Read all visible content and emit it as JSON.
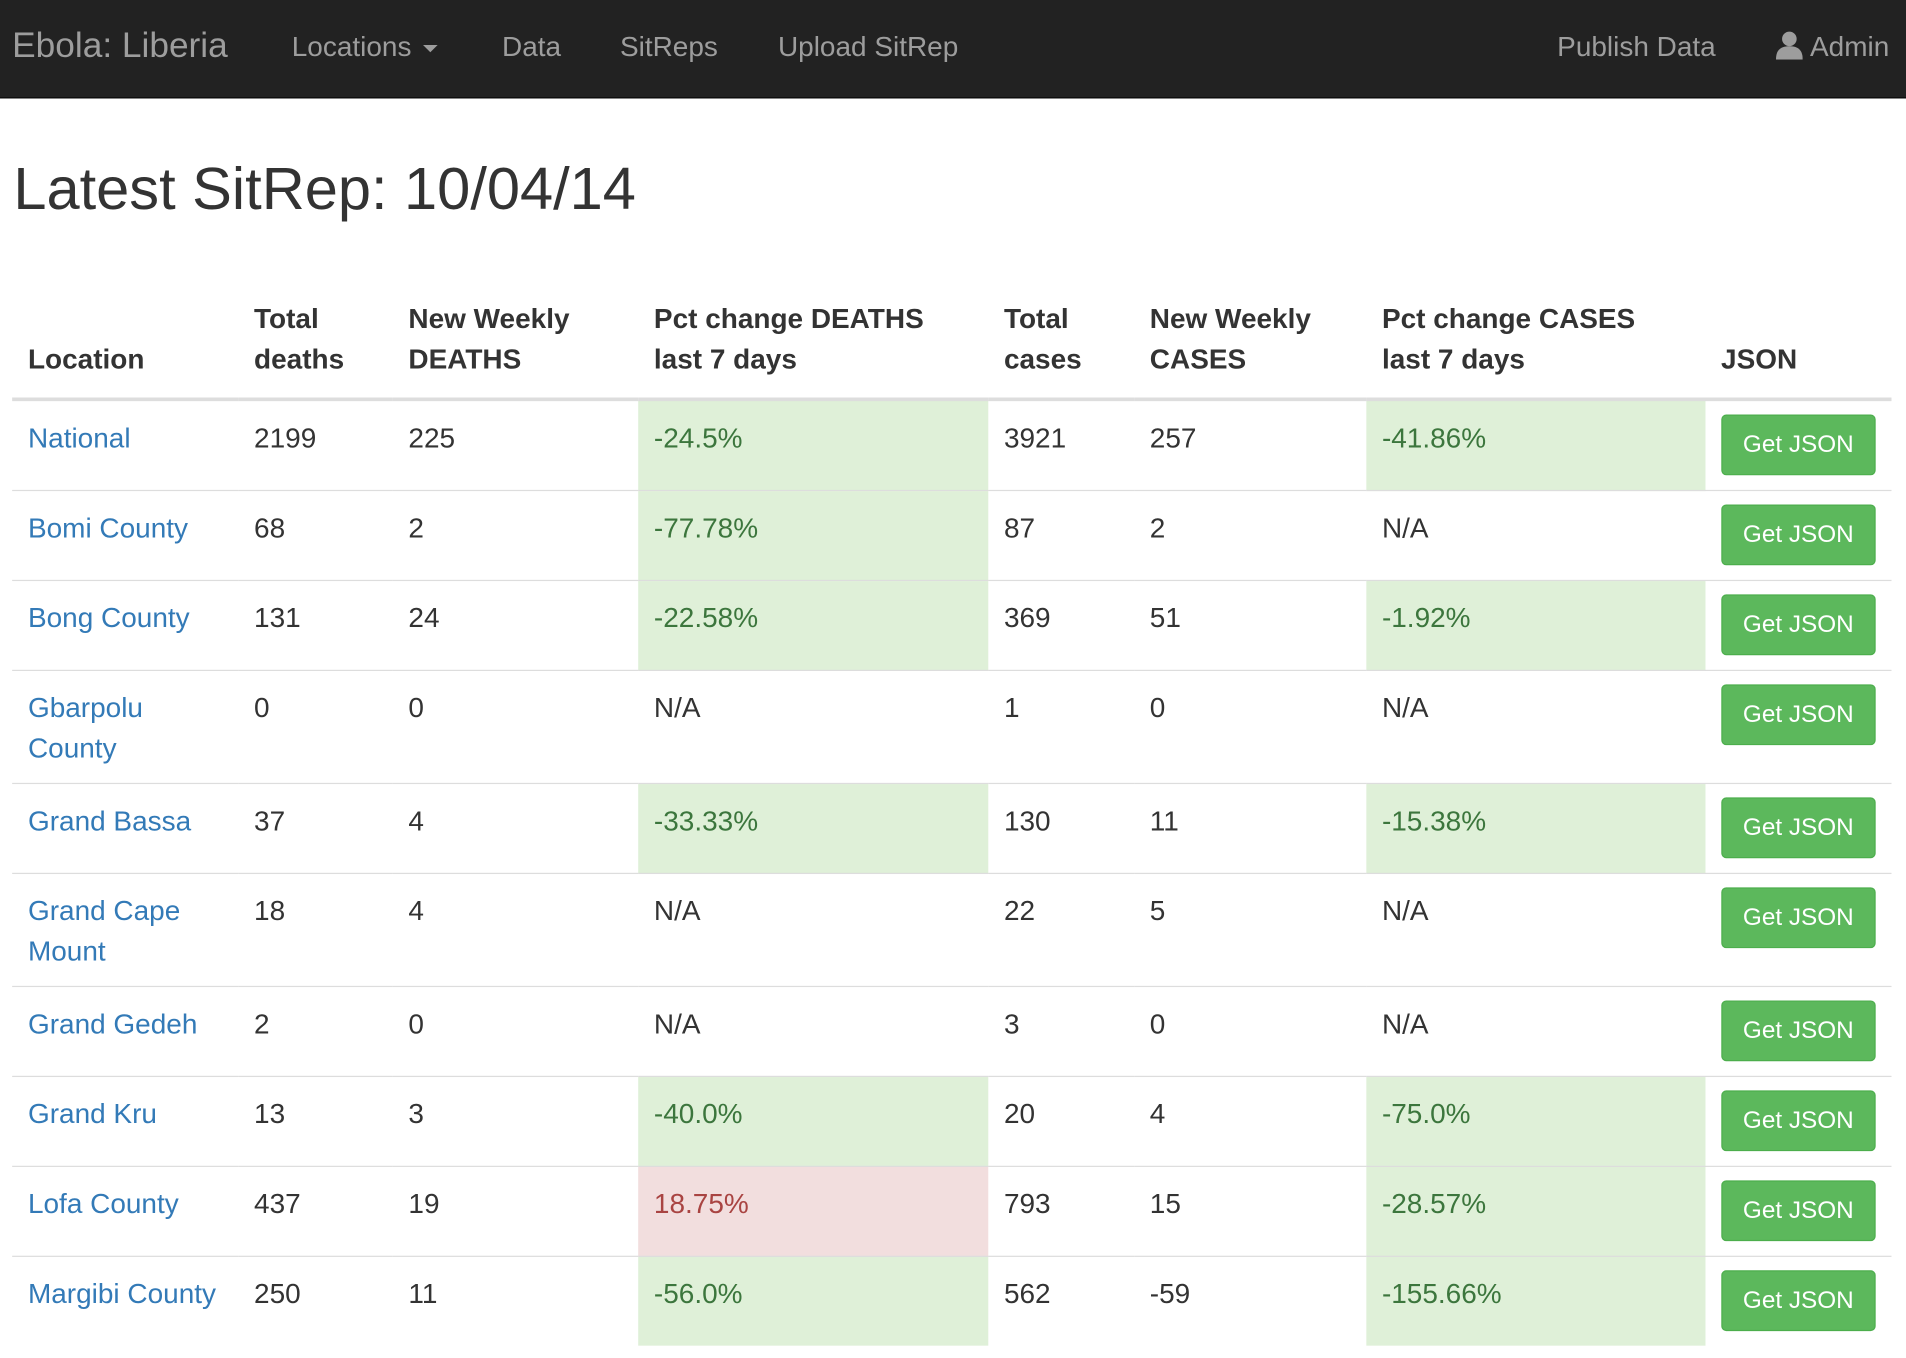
{
  "navbar": {
    "brand": "Ebola: Liberia",
    "locations": "Locations",
    "data": "Data",
    "sitreps": "SitReps",
    "upload": "Upload SitRep",
    "publish": "Publish Data",
    "admin": "Admin"
  },
  "page": {
    "title": "Latest SitRep: 10/04/14"
  },
  "table": {
    "headers": {
      "location": "Location",
      "total_deaths": [
        "Total",
        "deaths"
      ],
      "new_deaths": [
        "New Weekly",
        "DEATHS"
      ],
      "pct_deaths": [
        "Pct change DEATHS",
        "last 7 days"
      ],
      "total_cases": [
        "Total",
        "cases"
      ],
      "new_cases": [
        "New Weekly",
        "CASES"
      ],
      "pct_cases": [
        "Pct change CASES",
        "last 7 days"
      ],
      "json": "JSON"
    },
    "button_label": "Get JSON",
    "rows": [
      {
        "location": [
          "National"
        ],
        "total_deaths": "2199",
        "new_deaths": "225",
        "pct_deaths": "-24.5%",
        "total_cases": "3921",
        "new_cases": "257",
        "pct_cases": "-41.86%"
      },
      {
        "location": [
          "Bomi County"
        ],
        "total_deaths": "68",
        "new_deaths": "2",
        "pct_deaths": "-77.78%",
        "total_cases": "87",
        "new_cases": "2",
        "pct_cases": "N/A"
      },
      {
        "location": [
          "Bong County"
        ],
        "total_deaths": "131",
        "new_deaths": "24",
        "pct_deaths": "-22.58%",
        "total_cases": "369",
        "new_cases": "51",
        "pct_cases": "-1.92%"
      },
      {
        "location": [
          "Gbarpolu",
          "County"
        ],
        "total_deaths": "0",
        "new_deaths": "0",
        "pct_deaths": "N/A",
        "total_cases": "1",
        "new_cases": "0",
        "pct_cases": "N/A"
      },
      {
        "location": [
          "Grand Bassa"
        ],
        "total_deaths": "37",
        "new_deaths": "4",
        "pct_deaths": "-33.33%",
        "total_cases": "130",
        "new_cases": "11",
        "pct_cases": "-15.38%"
      },
      {
        "location": [
          "Grand Cape",
          "Mount"
        ],
        "total_deaths": "18",
        "new_deaths": "4",
        "pct_deaths": "N/A",
        "total_cases": "22",
        "new_cases": "5",
        "pct_cases": "N/A"
      },
      {
        "location": [
          "Grand Gedeh"
        ],
        "total_deaths": "2",
        "new_deaths": "0",
        "pct_deaths": "N/A",
        "total_cases": "3",
        "new_cases": "0",
        "pct_cases": "N/A"
      },
      {
        "location": [
          "Grand Kru"
        ],
        "total_deaths": "13",
        "new_deaths": "3",
        "pct_deaths": "-40.0%",
        "total_cases": "20",
        "new_cases": "4",
        "pct_cases": "-75.0%"
      },
      {
        "location": [
          "Lofa County"
        ],
        "total_deaths": "437",
        "new_deaths": "19",
        "pct_deaths": "18.75%",
        "total_cases": "793",
        "new_cases": "15",
        "pct_cases": "-28.57%"
      },
      {
        "location": [
          "Margibi County"
        ],
        "total_deaths": "250",
        "new_deaths": "11",
        "pct_deaths": "-56.0%",
        "total_cases": "562",
        "new_cases": "-59",
        "pct_cases": "-155.66%"
      }
    ]
  }
}
